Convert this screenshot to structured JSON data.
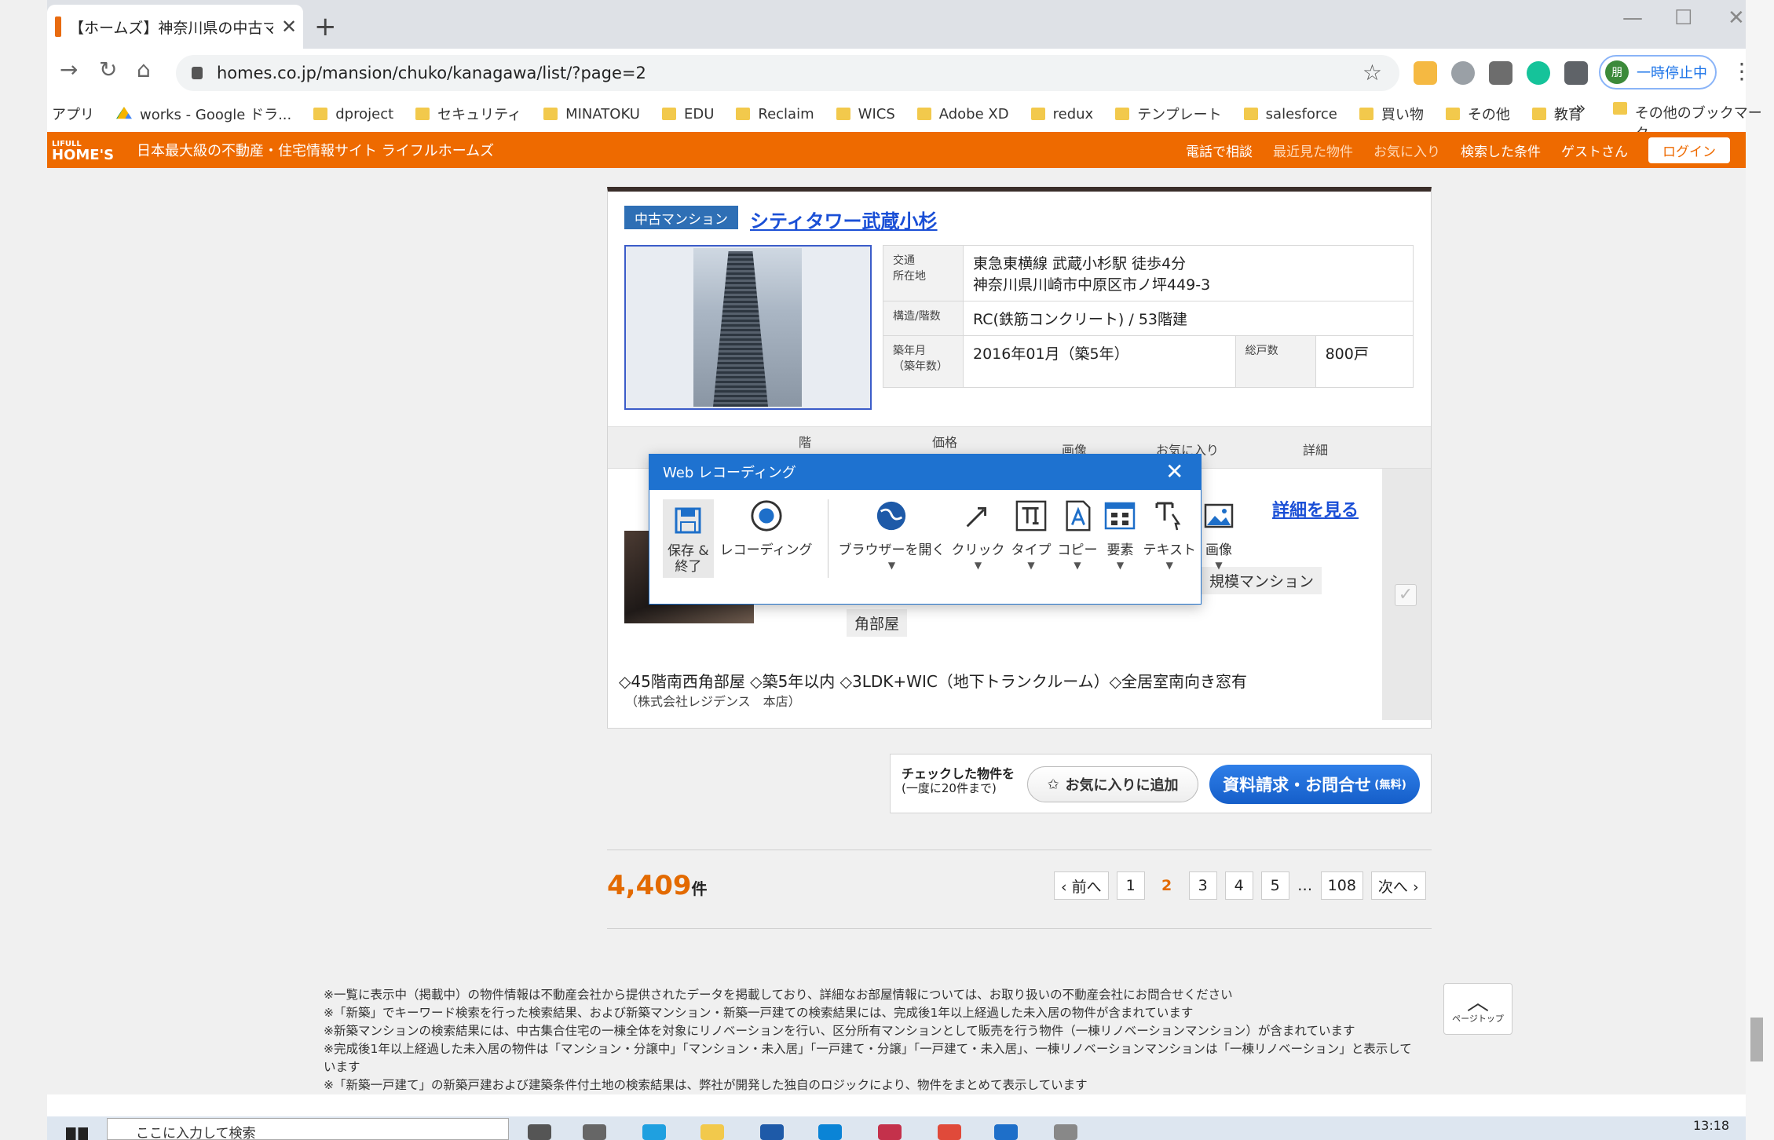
{
  "browser": {
    "tab_title": "【ホームズ】神奈川県の中古マンション",
    "url": "homes.co.jp/mansion/chuko/kanagawa/list/?page=2",
    "profile_initial": "朋",
    "profile_status": "一時停止中"
  },
  "bookmarks": {
    "items": [
      "アプリ",
      "works - Google ドラ...",
      "dproject",
      "セキュリティ",
      "MINATOKU",
      "EDU",
      "Reclaim",
      "WICS",
      "Adobe XD",
      "redux",
      "テンプレート",
      "salesforce",
      "買い物",
      "その他",
      "教育"
    ],
    "more": "»",
    "other": "その他のブックマーク"
  },
  "site_header": {
    "logo_top": "LIFULL",
    "logo_main": "HOME'S",
    "tagline": "日本最大級の不動産・住宅情報サイト ライフルホームズ",
    "links": [
      "電話で相談",
      "最近見た物件",
      "お気に入り",
      "検索した条件",
      "ゲストさん"
    ],
    "login": "ログイン"
  },
  "property": {
    "type": "中古マンション",
    "name": "シティタワー武蔵小杉",
    "access_label_1": "交通",
    "access_label_2": "所在地",
    "access_value_1": "東急東横線 武蔵小杉駅 徒歩4分",
    "access_value_2": "神奈川県川崎市中原区市ノ坪449-3",
    "structure_label": "構造/階数",
    "structure_value": "RC(鉄筋コンクリート) / 53階建",
    "built_label_1": "築年月",
    "built_label_2": "（築年数）",
    "built_value": "2016年01月（築5年）",
    "units_label": "総戸数",
    "units_value": "800戸"
  },
  "list_header": {
    "floor": "階",
    "price": "価格",
    "image": "画像",
    "favorite": "お気に入り",
    "detail": "詳細"
  },
  "listing": {
    "detail_link": "詳細を見る",
    "tag_large": "規模マンション",
    "tag_corner": "角部屋",
    "features": "◇45階南西角部屋 ◇築5年以内 ◇3LDK+WIC（地下トランクルーム）◇全居室南向き窓有",
    "agent": "（株式会社レジデンス　本店）",
    "checkbox": "✓"
  },
  "actions": {
    "label": "チェックした物件を",
    "sublabel": "(一度に20件まで)",
    "favorite": "お気に入りに追加",
    "inquiry": "資料請求・お問合せ",
    "inquiry_note": "(無料)"
  },
  "results": {
    "count": "4,409",
    "unit": "件",
    "prev": "‹ 前へ",
    "pages": [
      "1",
      "2",
      "3",
      "4",
      "5"
    ],
    "ellipsis": "…",
    "last": "108",
    "next": "次へ ›"
  },
  "notes": [
    "※一覧に表示中（掲載中）の物件情報は不動産会社から提供されたデータを掲載しており、詳細なお部屋情報については、お取り扱いの不動産会社にお問合せください",
    "※「新築」でキーワード検索を行った検索結果、および新築マンション・新築一戸建ての検索結果には、完成後1年以上経過した未入居の物件が含まれています",
    "※新築マンションの検索結果には、中古集合住宅の一棟全体を対象にリノベーションを行い、区分所有マンションとして販売を行う物件（一棟リノベーションマンション）が含まれています",
    "※完成後1年以上経過した未入居の物件は「マンション・分譲中」「マンション・未入居」「一戸建て・分譲」「一戸建て・未入居」、一棟リノベーションマンションは「一棟リノベーション」と表示しています",
    "※「新築一戸建て」の新築戸建および建築条件付土地の検索結果は、弊社が開発した独自のロジックにより、物件をまとめて表示しています"
  ],
  "pagetop": "ページトップ",
  "recorder": {
    "title": "Web レコーディング",
    "save_1": "保存 &",
    "save_2": "終了",
    "record": "レコーディング",
    "tools": [
      "ブラウザーを開く",
      "クリック",
      "タイプ",
      "コピー",
      "要素",
      "テキスト",
      "画像"
    ]
  },
  "taskbar": {
    "search_placeholder": "ここに入力して検索",
    "time": "13:18"
  }
}
